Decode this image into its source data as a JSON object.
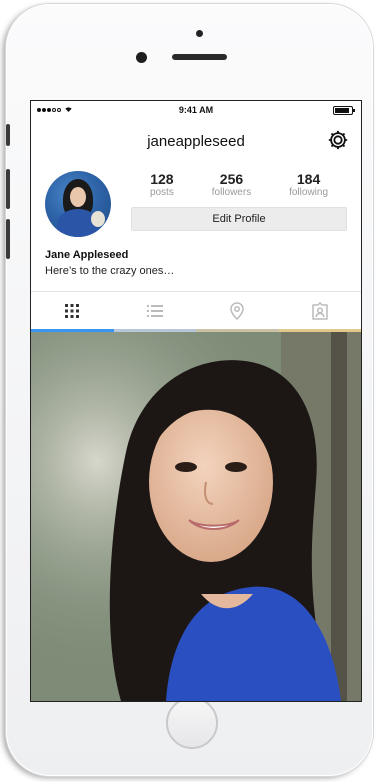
{
  "status_bar": {
    "time": "9:41 AM"
  },
  "profile": {
    "username": "janeappleseed",
    "name": "Jane Appleseed",
    "bio": "Here’s to the crazy ones…",
    "edit_button_label": "Edit Profile",
    "stats": [
      {
        "value": "128",
        "label": "posts"
      },
      {
        "value": "256",
        "label": "followers"
      },
      {
        "value": "184",
        "label": "following"
      }
    ]
  },
  "tabs": [
    {
      "icon": "grid-icon",
      "active": true
    },
    {
      "icon": "list-icon",
      "active": false
    },
    {
      "icon": "location-pin-icon",
      "active": false
    },
    {
      "icon": "tagged-person-icon",
      "active": false
    }
  ],
  "colors": {
    "active_tab": "#3897f0",
    "edit_button_bg": "#ececec",
    "stat_label": "#9a9a9a",
    "photo_shirt": "#2a4fc0"
  }
}
